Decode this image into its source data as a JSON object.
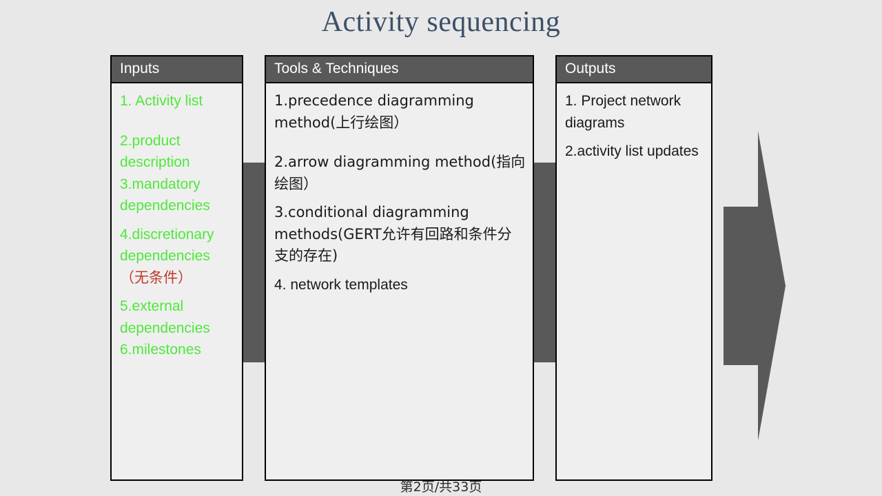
{
  "slide": {
    "title": "Activity sequencing",
    "footer": "第2页/共33页",
    "background_color": "#e8e8e8",
    "title_color": "#3d5068",
    "header_bg_color": "#595959",
    "green_text_color": "#4ee83a",
    "red_text_color": "#c0392b"
  },
  "panels": [
    {
      "header": "Inputs",
      "items": [
        {
          "text": "1. Activity list",
          "color": "green"
        },
        {
          "text": "2.product description",
          "color": "green"
        },
        {
          "text": "3.mandatory dependencies",
          "color": "green"
        },
        {
          "text": "4.discretionary dependencies",
          "color": "green"
        },
        {
          "text": "（无条件）",
          "color": "red"
        },
        {
          "text": "5.external dependencies",
          "color": "green"
        },
        {
          "text": "6.milestones",
          "color": "green"
        }
      ]
    },
    {
      "header": "Tools & Techniques",
      "items": [
        {
          "text": "1.precedence diagramming method(上行绘图）",
          "color": "dark"
        },
        {
          "text": "2.arrow diagramming method(指向绘图）",
          "color": "dark"
        },
        {
          "text": "3.conditional diagramming methods(GERT允许有回路和条件分支的存在)",
          "color": "dark"
        },
        {
          "text": "4. network templates",
          "color": "dark"
        }
      ]
    },
    {
      "header": "Outputs",
      "items": [
        {
          "text": "1. Project network diagrams",
          "color": "dark"
        },
        {
          "text": "2.activity list updates",
          "color": "dark"
        }
      ]
    }
  ],
  "arrow": {
    "name": "right-pointing-arrow",
    "color": "#595959"
  }
}
